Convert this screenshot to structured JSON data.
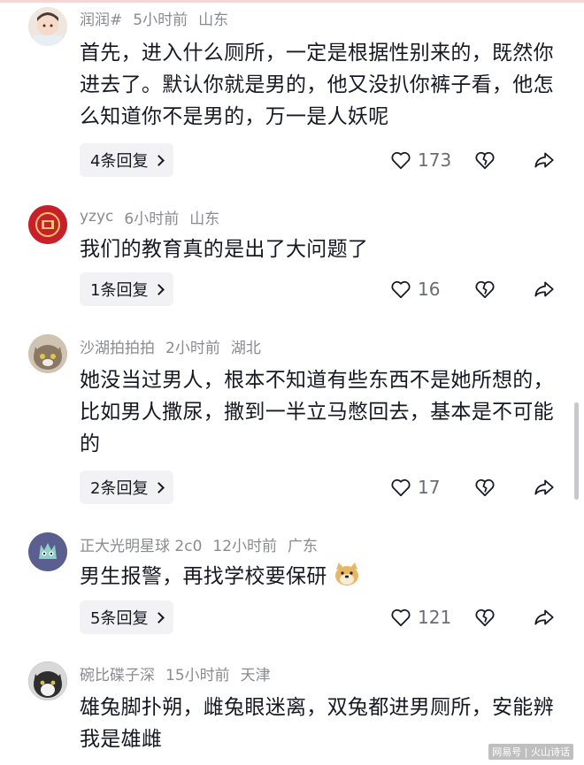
{
  "comments": [
    {
      "username": "润润#",
      "time": "5小时前",
      "location": "山东",
      "text": "首先，进入什么厕所，一定是根据性别来的，既然你进去了。默认你就是男的，他又没扒你裤子看，他怎么知道你不是男的，万一是人妖呢",
      "replies": "4条回复",
      "likes": "173",
      "avatar_color": "#e9ddd2"
    },
    {
      "username": "yzyc",
      "time": "6小时前",
      "location": "山东",
      "text": "我们的教育真的是出了大问题了",
      "replies": "1条回复",
      "likes": "16",
      "avatar_color": "#c8202a"
    },
    {
      "username": "沙湖拍拍拍",
      "time": "2小时前",
      "location": "湖北",
      "text": "她没当过男人，根本不知道有些东西不是她所想的，比如男人撒尿，撒到一半立马憋回去，基本是不可能的",
      "replies": "2条回复",
      "likes": "17",
      "avatar_color": "#9a8a78"
    },
    {
      "username": "正大光明星球 2c0",
      "time": "12小时前",
      "location": "广东",
      "text": "男生报警，再找学校要保研",
      "replies": "5条回复",
      "likes": "121",
      "avatar_color": "#5a5f8f"
    },
    {
      "username": "碗比碟子深",
      "time": "15小时前",
      "location": "天津",
      "text": "雄兔脚扑朔，雌兔眼迷离，双兔都进男厕所，安能辨我是雄雌",
      "avatar_color": "#3c3c3c"
    }
  ],
  "watermark": "网易号 | 火山诗话",
  "icons": {
    "like": "heart-icon",
    "dislike": "broken-heart-icon",
    "share": "share-arrow-icon",
    "expand": "chevron-right-icon"
  }
}
